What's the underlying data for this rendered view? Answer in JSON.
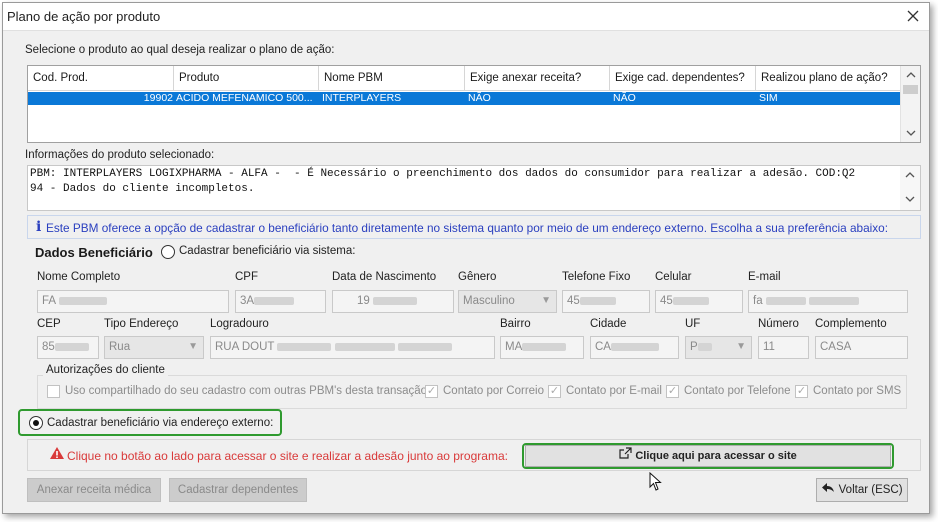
{
  "window": {
    "title": "Plano de ação por produto"
  },
  "select_label": "Selecione o produto ao qual deseja realizar o plano de ação:",
  "table": {
    "headers": [
      "Cod. Prod.",
      "Produto",
      "Nome PBM",
      "Exige anexar receita?",
      "Exige cad. dependentes?",
      "Realizou plano de ação?"
    ],
    "rows": [
      [
        "19902",
        "ACIDO MEFENAMICO 500...",
        "INTERPLAYERS",
        "NÃO",
        "NÃO",
        "SIM"
      ]
    ],
    "selected_row_color": "#0a78d7"
  },
  "info": {
    "label": "Informações do produto selecionado:",
    "line1": "PBM: INTERPLAYERS LOGIXPHARMA - ALFA -  - É Necessário o preenchimento dos dados do consumidor para realizar a adesão. COD:Q2",
    "line2": "94 - Dados do cliente incompletos."
  },
  "hint": {
    "icon": "i",
    "text": "Este PBM oferece a opção de cadastrar o beneficiário tanto diretamente no sistema quanto por meio de um endereço externo. Escolha a sua preferência abaixo:"
  },
  "beneficiario": {
    "title": "Dados Beneficiário",
    "radio_sistema": "Cadastrar beneficiário via sistema:",
    "labels": {
      "nome": "Nome Completo",
      "cpf": "CPF",
      "nascimento": "Data de Nascimento",
      "genero": "Gênero",
      "telefone": "Telefone Fixo",
      "celular": "Celular",
      "email": "E-mail",
      "cep": "CEP",
      "tipo_endereco": "Tipo Endereço",
      "logradouro": "Logradouro",
      "bairro": "Bairro",
      "cidade": "Cidade",
      "uf": "UF",
      "numero": "Número",
      "complemento": "Complemento"
    },
    "values": {
      "nome": "FA",
      "cpf": "3A",
      "nascimento": "19",
      "genero": "Masculino",
      "telefone": "45",
      "celular": "45",
      "email": "fa",
      "cep": "85",
      "tipo_endereco": "Rua",
      "logradouro": "RUA DOUT",
      "bairro": "MA",
      "cidade": "CA",
      "uf": "P",
      "numero": "11",
      "complemento": "CASA"
    }
  },
  "autorizacoes": {
    "title": "Autorizações do cliente",
    "uso_compartilhado": "Uso compartilhado do seu cadastro com outras PBM's desta transação.",
    "correio": "Contato por Correio",
    "email": "Contato por E-mail",
    "telefone": "Contato por Telefone",
    "sms": "Contato por SMS"
  },
  "externo": {
    "radio_label": "Cadastrar beneficiário via endereço externo:",
    "warning": "Clique no botão ao lado para acessar o site e realizar a adesão junto ao programa:",
    "site_button": "Clique aqui para acessar o site"
  },
  "buttons": {
    "anexar": "Anexar receita médica",
    "dependentes": "Cadastrar dependentes",
    "voltar": "Voltar (ESC)"
  },
  "colors": {
    "highlight": "#2f9a2f",
    "warning": "#d93a3a",
    "hint": "#2a3fbf"
  }
}
